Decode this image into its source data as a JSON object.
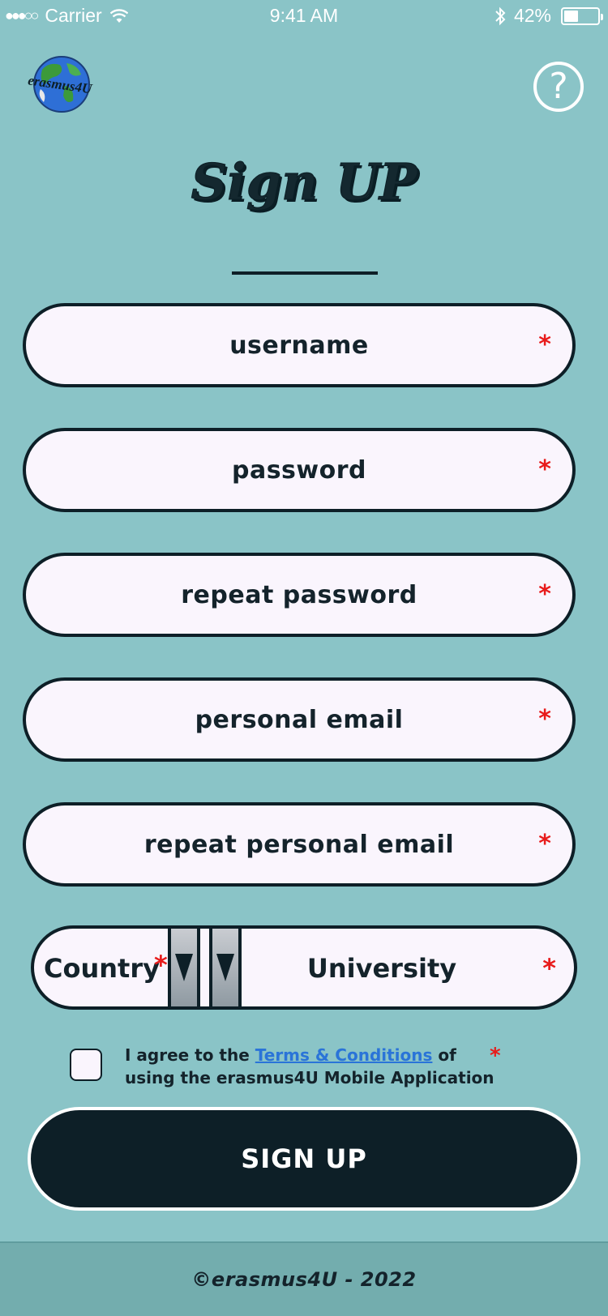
{
  "status_bar": {
    "signal": "●●●○○",
    "carrier": "Carrier",
    "time": "9:41 AM",
    "battery": "42%",
    "battery_level": 0.42
  },
  "header": {
    "logo_text": "erasmus4U",
    "help_label": "?"
  },
  "title": "Sign UP",
  "form": {
    "fields": [
      {
        "label": "username",
        "required": "*"
      },
      {
        "label": "password",
        "required": "*"
      },
      {
        "label": "repeat password",
        "required": "*"
      },
      {
        "label": "personal email",
        "required": "*"
      },
      {
        "label": "repeat personal email",
        "required": "*"
      }
    ],
    "country_label": "Country",
    "university_label": "University",
    "required_mark": "*"
  },
  "terms": {
    "prefix": "I agree to the ",
    "link": "Terms & Conditions",
    "suffix": " of using the erasmus4U Mobile Application",
    "required": "*"
  },
  "signup_button": "SIGN UP",
  "footer": "©erasmus4U - 2022",
  "colors": {
    "background": "#8ac4c7",
    "dark": "#0d1f27",
    "field": "#faf5fd",
    "required": "#e81b1b",
    "link": "#2a74d8",
    "footer": "#73adae"
  }
}
